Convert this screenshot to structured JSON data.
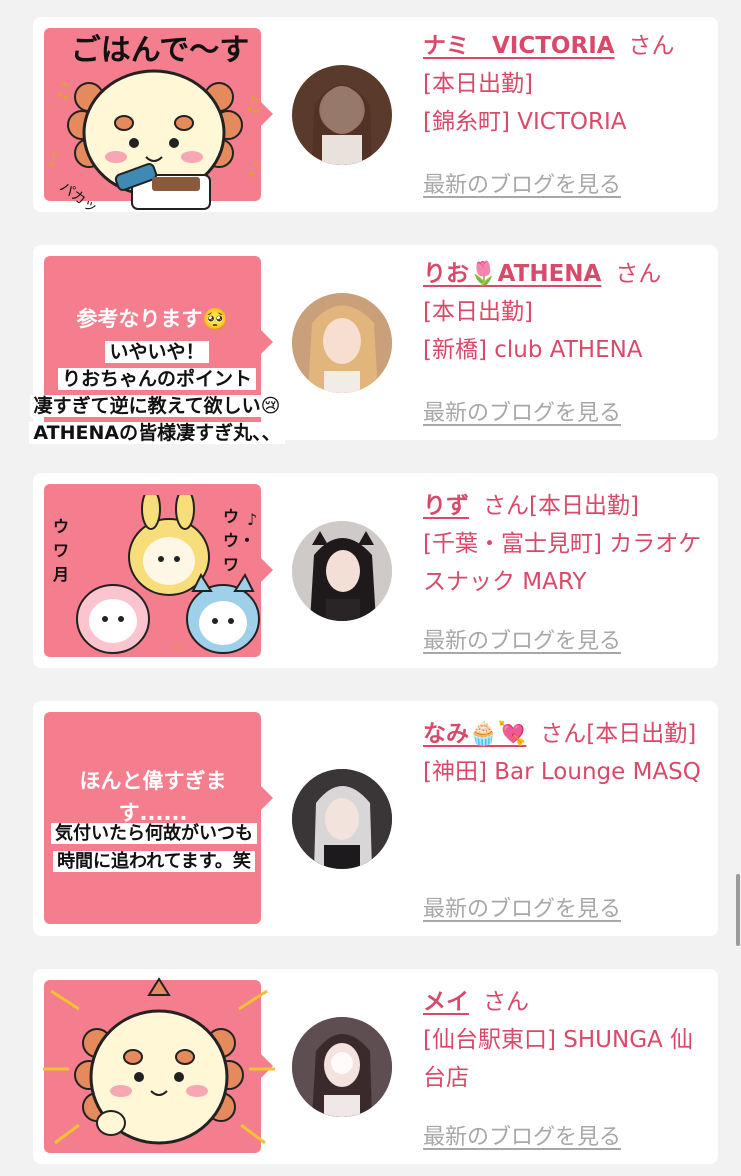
{
  "colors": {
    "accent": "#d94a6a",
    "bubble": "#f47d8e",
    "link_gray": "#a8a8a8",
    "background": "#f2f2f2"
  },
  "entries": [
    {
      "name": "ナミ　VICTORIA",
      "honorific": "さん",
      "status": "[本日出勤]",
      "shop": "[錦糸町] VICTORIA",
      "blog_link": "最新のブログを見る",
      "sticker_caption": "ごはんで〜す",
      "sticker_sfx": "パカッ"
    },
    {
      "name": "りお🌷ATHENA",
      "honorific": "さん",
      "status": "[本日出勤]",
      "shop": "[新橋] club ATHENA",
      "blog_link": "最新のブログを見る",
      "bubble_text": "参考なります🥺",
      "overlay_lines": [
        "いやいや！",
        "りおちゃんのポイント",
        "凄すぎて逆に教えて欲しい😢",
        "ATHENAの皆様凄すぎ丸、、"
      ]
    },
    {
      "name": "りず",
      "honorific": "さん",
      "status_inline": "[本日出勤]",
      "shop": "[千葉・富士見町] カラオケスナック MARY",
      "blog_link": "最新のブログを見る",
      "sticker_sfx_left": "ウワ月",
      "sticker_sfx_right": "ウウ・ワ"
    },
    {
      "name": "なみ🧁💘",
      "honorific": "さん",
      "status_inline": "[本日出勤]",
      "shop": "[神田] Bar Lounge MASQ",
      "blog_link": "最新のブログを見る",
      "bubble_text": "ほんと偉すぎます......",
      "overlay_lines": [
        "気付いたら何故がいつも",
        "時間に追われてます。笑"
      ]
    },
    {
      "name": "メイ",
      "honorific": "さん",
      "status": "",
      "shop": "[仙台駅東口] SHUNGA 仙台店",
      "blog_link": "最新のブログを見る"
    }
  ]
}
